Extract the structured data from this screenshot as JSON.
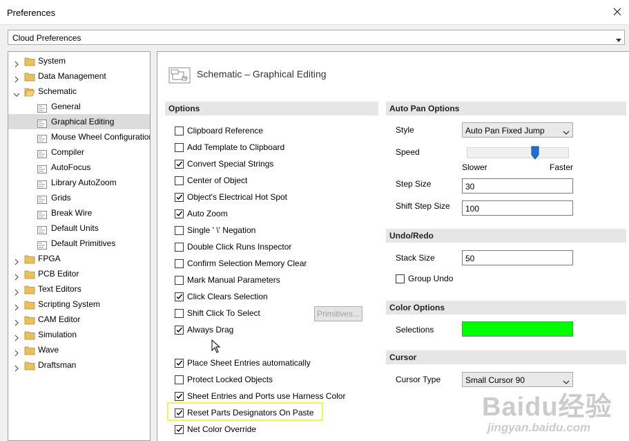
{
  "window": {
    "title": "Preferences"
  },
  "profile_dropdown": {
    "value": "Cloud Preferences"
  },
  "tree": [
    {
      "label": "System",
      "level": 0,
      "expanded": false,
      "selected": false
    },
    {
      "label": "Data Management",
      "level": 0,
      "expanded": false,
      "selected": false
    },
    {
      "label": "Schematic",
      "level": 0,
      "expanded": true,
      "selected": false
    },
    {
      "label": "General",
      "level": 1,
      "selected": false
    },
    {
      "label": "Graphical Editing",
      "level": 1,
      "selected": true
    },
    {
      "label": "Mouse Wheel Configuration",
      "level": 1,
      "selected": false
    },
    {
      "label": "Compiler",
      "level": 1,
      "selected": false
    },
    {
      "label": "AutoFocus",
      "level": 1,
      "selected": false
    },
    {
      "label": "Library AutoZoom",
      "level": 1,
      "selected": false
    },
    {
      "label": "Grids",
      "level": 1,
      "selected": false
    },
    {
      "label": "Break Wire",
      "level": 1,
      "selected": false
    },
    {
      "label": "Default Units",
      "level": 1,
      "selected": false
    },
    {
      "label": "Default Primitives",
      "level": 1,
      "selected": false
    },
    {
      "label": "FPGA",
      "level": 0,
      "expanded": false,
      "selected": false
    },
    {
      "label": "PCB Editor",
      "level": 0,
      "expanded": false,
      "selected": false
    },
    {
      "label": "Text Editors",
      "level": 0,
      "expanded": false,
      "selected": false
    },
    {
      "label": "Scripting System",
      "level": 0,
      "expanded": false,
      "selected": false
    },
    {
      "label": "CAM Editor",
      "level": 0,
      "expanded": false,
      "selected": false
    },
    {
      "label": "Simulation",
      "level": 0,
      "expanded": false,
      "selected": false
    },
    {
      "label": "Wave",
      "level": 0,
      "expanded": false,
      "selected": false
    },
    {
      "label": "Draftsman",
      "level": 0,
      "expanded": false,
      "selected": false
    }
  ],
  "page": {
    "title": "Schematic – Graphical Editing"
  },
  "options": {
    "header": "Options",
    "items": [
      {
        "label": "Clipboard Reference",
        "checked": false
      },
      {
        "label": "Add Template to Clipboard",
        "checked": false
      },
      {
        "label": "Convert Special Strings",
        "checked": true
      },
      {
        "label": "Center of Object",
        "checked": false
      },
      {
        "label": "Object's Electrical Hot Spot",
        "checked": true
      },
      {
        "label": "Auto Zoom",
        "checked": true
      },
      {
        "label": "Single ' \\' Negation",
        "checked": false
      },
      {
        "label": "Double Click Runs Inspector",
        "checked": false
      },
      {
        "label": "Confirm Selection Memory Clear",
        "checked": false
      },
      {
        "label": "Mark Manual Parameters",
        "checked": false
      },
      {
        "label": "Click Clears Selection",
        "checked": true
      },
      {
        "label": "Shift Click To Select",
        "checked": false
      },
      {
        "label": "Always Drag",
        "checked": true
      },
      {
        "label": "Place Sheet Entries automatically",
        "checked": true
      },
      {
        "label": "Protect Locked Objects",
        "checked": false
      },
      {
        "label": "Sheet Entries and Ports use Harness Color",
        "checked": true
      },
      {
        "label": "Reset Parts Designators On Paste",
        "checked": true
      },
      {
        "label": "Net Color Override",
        "checked": true
      }
    ],
    "primitives_button": "Primitives..."
  },
  "auto_pan": {
    "header": "Auto Pan Options",
    "style_label": "Style",
    "style_value": "Auto Pan Fixed Jump",
    "speed_label": "Speed",
    "speed_level": 0.67,
    "slower_label": "Slower",
    "faster_label": "Faster",
    "step_size_label": "Step Size",
    "step_size_value": "30",
    "shift_step_size_label": "Shift Step Size",
    "shift_step_size_value": "100"
  },
  "undo_redo": {
    "header": "Undo/Redo",
    "stack_size_label": "Stack Size",
    "stack_size_value": "50",
    "group_undo_label": "Group Undo",
    "group_undo_checked": false
  },
  "color_options": {
    "header": "Color Options",
    "selections_label": "Selections",
    "selections_color": "#00ff00"
  },
  "cursor": {
    "header": "Cursor",
    "cursor_type_label": "Cursor Type",
    "cursor_type_value": "Small Cursor 90"
  },
  "watermark": {
    "logo": "Baidu经验",
    "url": "jingyan.baidu.com"
  },
  "colors": {
    "selection_bg": "#dcdcdc",
    "section_bg": "#e6e6e6",
    "highlight": "#f3f354",
    "folder": "#e8c15c"
  }
}
